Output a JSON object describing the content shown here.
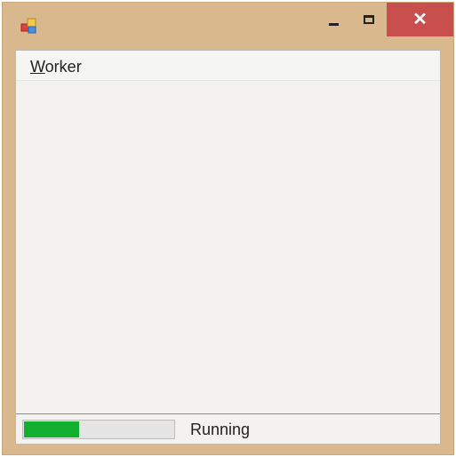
{
  "window": {
    "icon": "windows-forms-app-icon",
    "controls": {
      "minimize": "minimize-icon",
      "maximize": "maximize-icon",
      "close_glyph": "✕"
    }
  },
  "menu": {
    "items": [
      {
        "mnemonic": "W",
        "rest": "orker"
      }
    ]
  },
  "status": {
    "progress": 0.37,
    "progress_color": "#13b02f",
    "text": "Running"
  },
  "colors": {
    "frame": "#d8b88c",
    "close_button": "#c94e4e",
    "client": "#f3f2f1"
  }
}
